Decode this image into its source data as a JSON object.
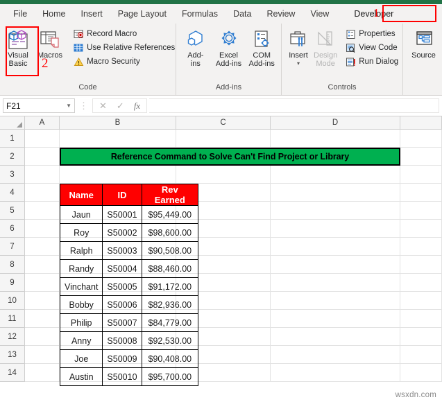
{
  "window": {
    "accent_color": "#217346"
  },
  "ribbon": {
    "tabs": [
      {
        "label": "File"
      },
      {
        "label": "Home"
      },
      {
        "label": "Insert"
      },
      {
        "label": "Page Layout"
      },
      {
        "label": "Formulas"
      },
      {
        "label": "Data"
      },
      {
        "label": "Review"
      },
      {
        "label": "View"
      },
      {
        "label": "Developer"
      }
    ],
    "annotations": [
      {
        "text": "1",
        "color": "#ff0000",
        "target": "developer-tab"
      },
      {
        "text": "2",
        "color": "#ff0000",
        "target": "visual-basic-button"
      }
    ],
    "groups": [
      {
        "label": "Code",
        "big_buttons": [
          {
            "line1": "Visual",
            "line2": "Basic",
            "icon": "visual-basic-icon"
          },
          {
            "line1": "Macros",
            "line2": "",
            "icon": "macros-icon"
          }
        ],
        "small_buttons": [
          {
            "label": "Record Macro",
            "icon": "record-macro-icon"
          },
          {
            "label": "Use Relative References",
            "icon": "relative-references-icon"
          },
          {
            "label": "Macro Security",
            "icon": "macro-security-icon"
          }
        ]
      },
      {
        "label": "Add-ins",
        "big_buttons": [
          {
            "line1": "Add-",
            "line2": "ins",
            "icon": "add-ins-icon"
          },
          {
            "line1": "Excel",
            "line2": "Add-ins",
            "icon": "excel-add-ins-icon"
          },
          {
            "line1": "COM",
            "line2": "Add-ins",
            "icon": "com-add-ins-icon"
          }
        ],
        "small_buttons": []
      },
      {
        "label": "Controls",
        "big_buttons": [
          {
            "line1": "Insert",
            "line2": "",
            "icon": "insert-control-icon"
          },
          {
            "line1": "Design",
            "line2": "Mode",
            "icon": "design-mode-icon",
            "disabled": true
          }
        ],
        "small_buttons": [
          {
            "label": "Properties",
            "icon": "properties-icon"
          },
          {
            "label": "View Code",
            "icon": "view-code-icon"
          },
          {
            "label": "Run Dialog",
            "icon": "run-dialog-icon"
          }
        ]
      },
      {
        "label": "",
        "big_buttons": [
          {
            "line1": "Source",
            "line2": "",
            "icon": "xml-source-icon"
          }
        ],
        "small_buttons": []
      }
    ]
  },
  "formula_bar": {
    "name_box_value": "F21",
    "cancel_icon": "cancel-icon",
    "confirm_icon": "confirm-icon",
    "function_icon": "insert-function-icon",
    "formula_value": ""
  },
  "grid": {
    "column_headers": [
      "A",
      "B",
      "C",
      "D",
      ""
    ],
    "row_headers": [
      "1",
      "2",
      "3",
      "4",
      "5",
      "6",
      "7",
      "8",
      "9",
      "10",
      "11",
      "12",
      "13",
      "14"
    ]
  },
  "sheet": {
    "title": "Reference Command to Solve Can't Find Project or Library",
    "title_bg": "#00B050",
    "header_bg": "#FF0000",
    "headers": [
      "Name",
      "ID",
      "Rev Earned"
    ],
    "rows": [
      {
        "name": "Jaun",
        "id": "S50001",
        "currency": "$",
        "amount": "95,449.00"
      },
      {
        "name": "Roy",
        "id": "S50002",
        "currency": "$",
        "amount": "98,600.00"
      },
      {
        "name": "Ralph",
        "id": "S50003",
        "currency": "$",
        "amount": "90,508.00"
      },
      {
        "name": "Randy",
        "id": "S50004",
        "currency": "$",
        "amount": "88,460.00"
      },
      {
        "name": "Vinchant",
        "id": "S50005",
        "currency": "$",
        "amount": "91,172.00"
      },
      {
        "name": "Bobby",
        "id": "S50006",
        "currency": "$",
        "amount": "82,936.00"
      },
      {
        "name": "Philip",
        "id": "S50007",
        "currency": "$",
        "amount": "84,779.00"
      },
      {
        "name": "Anny",
        "id": "S50008",
        "currency": "$",
        "amount": "92,530.00"
      },
      {
        "name": "Joe",
        "id": "S50009",
        "currency": "$",
        "amount": "90,408.00"
      },
      {
        "name": "Austin",
        "id": "S50010",
        "currency": "$",
        "amount": "95,700.00"
      }
    ]
  },
  "watermark": {
    "text": "wsxdn.com"
  }
}
